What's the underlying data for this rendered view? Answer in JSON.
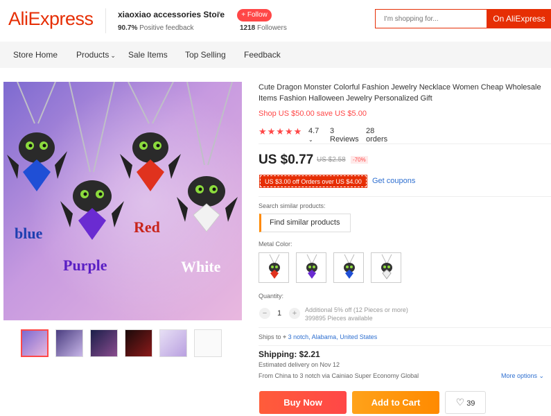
{
  "header": {
    "logo": "AliExpress",
    "store_name": "xiaoxiao accessories Store",
    "feedback_pct": "90.7%",
    "feedback_label": "Positive feedback",
    "follow_label": "+ Follow",
    "followers_count": "1218",
    "followers_label": "Followers",
    "search_placeholder": "I'm shopping for...",
    "search_button": "On AliExpress"
  },
  "nav": {
    "items": [
      "Store Home",
      "Products",
      "Sale Items",
      "Top Selling",
      "Feedback"
    ]
  },
  "gallery": {
    "labels": [
      "blue",
      "Purple",
      "Red",
      "White"
    ],
    "thumb_count": 6
  },
  "product": {
    "title": "Cute Dragon Monster Colorful Fashion Jewelry Necklace Women Cheap Wholesale Items Fashion Halloween Jewelry Personalized Gift",
    "shop_promo": "Shop US $50.00 save US $5.00",
    "rating": "4.7",
    "reviews": "3 Reviews",
    "orders": "28 orders",
    "price": "US $0.77",
    "original_price": "US $2.58",
    "discount": "-70%",
    "coupon": "US $3.00 off Orders over US $4.00",
    "get_coupons": "Get coupons",
    "similar_label": "Search similar products:",
    "find_similar": "Find similar products",
    "metal_color_label": "Metal Color:",
    "quantity_label": "Quantity:",
    "quantity_value": "1",
    "qty_note_1": "Additional 5% off (12 Pieces or more)",
    "qty_note_2": "399895 Pieces available",
    "ships_to_label": "Ships to",
    "ships_to": "3 notch, Alabama, United States",
    "shipping": "Shipping: $2.21",
    "eta": "Estimated delivery on Nov 12",
    "route": "From China to 3 notch via Cainiao Super Economy Global",
    "more_options": "More options",
    "buy_now": "Buy Now",
    "add_to_cart": "Add to Cart",
    "wishlist_count": "39"
  },
  "colors": {
    "brand": "#e62e04",
    "accent_red": "#ff4747",
    "accent_orange": "#ff8a00",
    "link": "#2e6fd0"
  }
}
